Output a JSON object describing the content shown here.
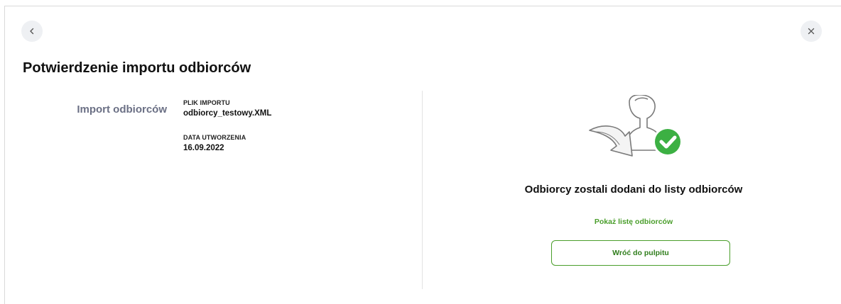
{
  "header": {
    "back_icon": "chevron-left-icon",
    "close_icon": "close-icon"
  },
  "page": {
    "title": "Potwierdzenie importu odbiorców"
  },
  "details": {
    "section_label": "Import odbiorców",
    "file_label": "PLIK IMPORTU",
    "file_value": "odbiorcy_testowy.XML",
    "date_label": "DATA UTWORZENIA",
    "date_value": "16.09.2022"
  },
  "result": {
    "illustration": "user-import-success-illustration",
    "message": "Odbiorcy zostali dodani do listy odbiorców",
    "show_list_link": "Pokaż listę odbiorców",
    "back_to_dashboard_button": "Wróć do pulpitu"
  },
  "colors": {
    "accent_green": "#4a9e2b",
    "section_label_gray": "#6b7085",
    "check_green": "#3cb043"
  }
}
